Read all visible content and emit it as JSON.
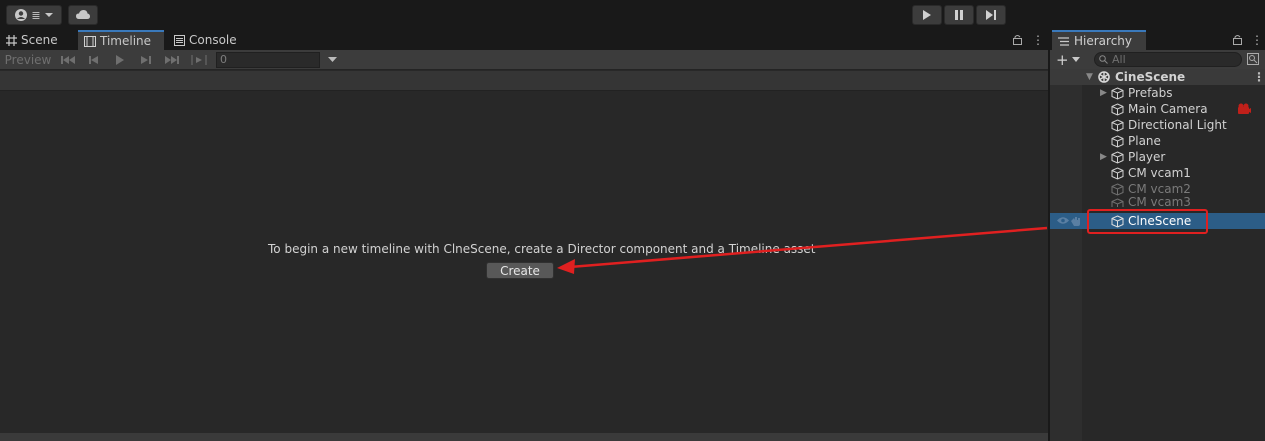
{
  "toolbar": {
    "account_icon": "account-icon",
    "layers_glyph": "≣",
    "cloud_icon": "cloud-icon",
    "play_icon": "play-icon",
    "pause_icon": "pause-icon",
    "step_icon": "step-icon"
  },
  "tabs": [
    {
      "label": "Scene",
      "icon": "grid-icon"
    },
    {
      "label": "Timeline",
      "icon": "film-icon"
    },
    {
      "label": "Console",
      "icon": "console-icon"
    }
  ],
  "timeline": {
    "preview_label": "Preview",
    "time_value": "0",
    "message": "To begin a new timeline with ClneScene, create a Director component and a Timeline asset",
    "create_label": "Create"
  },
  "hierarchy": {
    "tab_label": "Hierarchy",
    "search_placeholder": "All",
    "scene_name": "CineScene",
    "items": [
      {
        "label": "Prefabs",
        "expandable": true,
        "dim": false
      },
      {
        "label": "Main Camera",
        "expandable": false,
        "dim": false
      },
      {
        "label": "Directional Light",
        "expandable": false,
        "dim": false
      },
      {
        "label": "Plane",
        "expandable": false,
        "dim": false
      },
      {
        "label": "Player",
        "expandable": true,
        "dim": false
      },
      {
        "label": "CM vcam1",
        "expandable": false,
        "dim": false
      },
      {
        "label": "CM vcam2",
        "expandable": false,
        "dim": true
      },
      {
        "label": "CM vcam3",
        "expandable": false,
        "dim": true
      },
      {
        "label": "ClneScene",
        "expandable": false,
        "dim": false,
        "selected": true
      }
    ]
  },
  "colors": {
    "accent": "#3a79bb",
    "selection": "#2c5d87",
    "annotation_red": "#e02020"
  }
}
